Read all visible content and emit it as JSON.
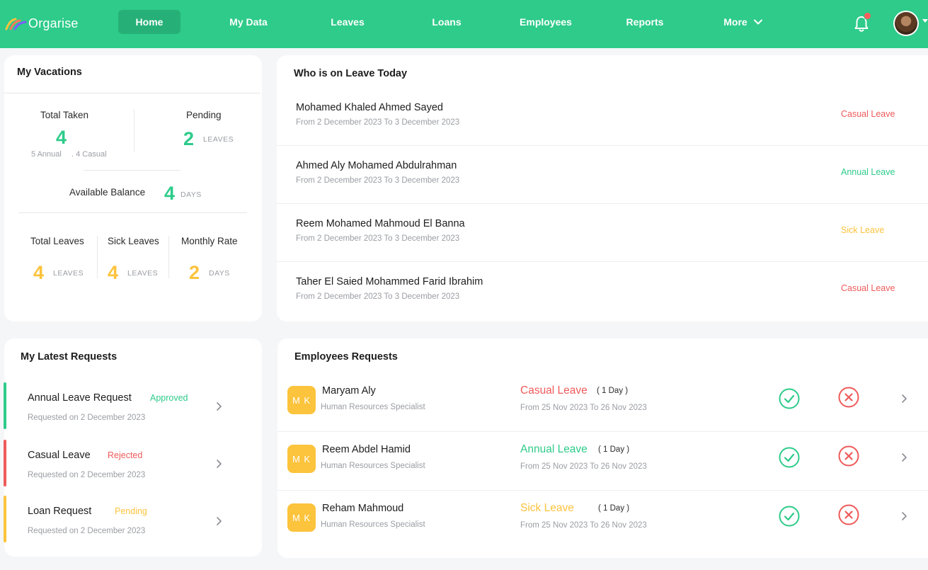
{
  "app": {
    "name": "Orgarise"
  },
  "nav": {
    "items": [
      {
        "label": "Home",
        "active": true
      },
      {
        "label": "My Data"
      },
      {
        "label": "Leaves"
      },
      {
        "label": "Loans"
      },
      {
        "label": "Employees"
      },
      {
        "label": "Reports"
      },
      {
        "label": "More"
      }
    ]
  },
  "colors": {
    "brand": "#2ecb8a",
    "brand_dark": "#26b077",
    "casual": "#ef5a5a",
    "annual": "#2ecb8a",
    "sick": "#fcc33c"
  },
  "icons": {
    "notifications": "bell-icon",
    "profile": "avatar",
    "more": "chevron-down-icon"
  },
  "vacations": {
    "title": "My Vacations",
    "total_taken": {
      "label": "Total Taken",
      "value": "4",
      "breakdown_annual": "5 Annual",
      "breakdown_casual": ". 4 Casual"
    },
    "pending": {
      "label": "Pending",
      "value": "2",
      "unit": "LEAVES"
    },
    "available": {
      "label": "Available Balance",
      "value": "4",
      "unit": "DAYS"
    },
    "total_leaves": {
      "label": "Total Leaves",
      "value": "4",
      "unit": "LEAVES"
    },
    "sick_leaves": {
      "label": "Sick Leaves",
      "value": "4",
      "unit": "LEAVES"
    },
    "monthly_rate": {
      "label": "Monthly Rate",
      "value": "2",
      "unit": "DAYS"
    }
  },
  "on_leave": {
    "title": "Who is on Leave Today",
    "rows": [
      {
        "name": "Mohamed Khaled Ahmed Sayed",
        "dates": "From 2 December 2023 To 3 December 2023",
        "type": "Casual Leave"
      },
      {
        "name": "Ahmed Aly Mohamed Abdulrahman",
        "dates": "From 2 December 2023 To 3 December 2023",
        "type": "Annual Leave"
      },
      {
        "name": "Reem Mohamed Mahmoud El Banna",
        "dates": "From 2 December 2023 To 3 December 2023",
        "type": "Sick Leave"
      },
      {
        "name": "Taher El Saied Mohammed Farid Ibrahim",
        "dates": "From 2 December 2023 To 3 December 2023",
        "type": "Casual Leave"
      }
    ]
  },
  "latest_requests": {
    "title": "My Latest Requests",
    "rows": [
      {
        "title": "Annual Leave Request",
        "status": "Approved",
        "date": "Requested on 2 December 2023"
      },
      {
        "title": "Casual Leave",
        "status": "Rejected",
        "date": "Requested on 2 December 2023"
      },
      {
        "title": "Loan Request",
        "status": "Pending",
        "date": "Requested on 2 December 2023"
      }
    ]
  },
  "employee_requests": {
    "title": "Employees Requests",
    "rows": [
      {
        "initials": "M K",
        "name": "Maryam Aly",
        "role": "Human Resources Specialist",
        "type": "Casual Leave",
        "days": "( 1 Day )",
        "dates": "From 25 Nov 2023 To 26 Nov 2023"
      },
      {
        "initials": "M K",
        "name": "Reem Abdel Hamid",
        "role": "Human Resources Specialist",
        "type": "Annual Leave",
        "days": "( 1 Day )",
        "dates": "From 25 Nov 2023 To 26 Nov 2023"
      },
      {
        "initials": "M K",
        "name": "Reham Mahmoud",
        "role": "Human Resources Specialist",
        "type": "Sick Leave",
        "days": "( 1 Day )",
        "dates": "From 25 Nov 2023 To 26 Nov 2023"
      }
    ]
  }
}
